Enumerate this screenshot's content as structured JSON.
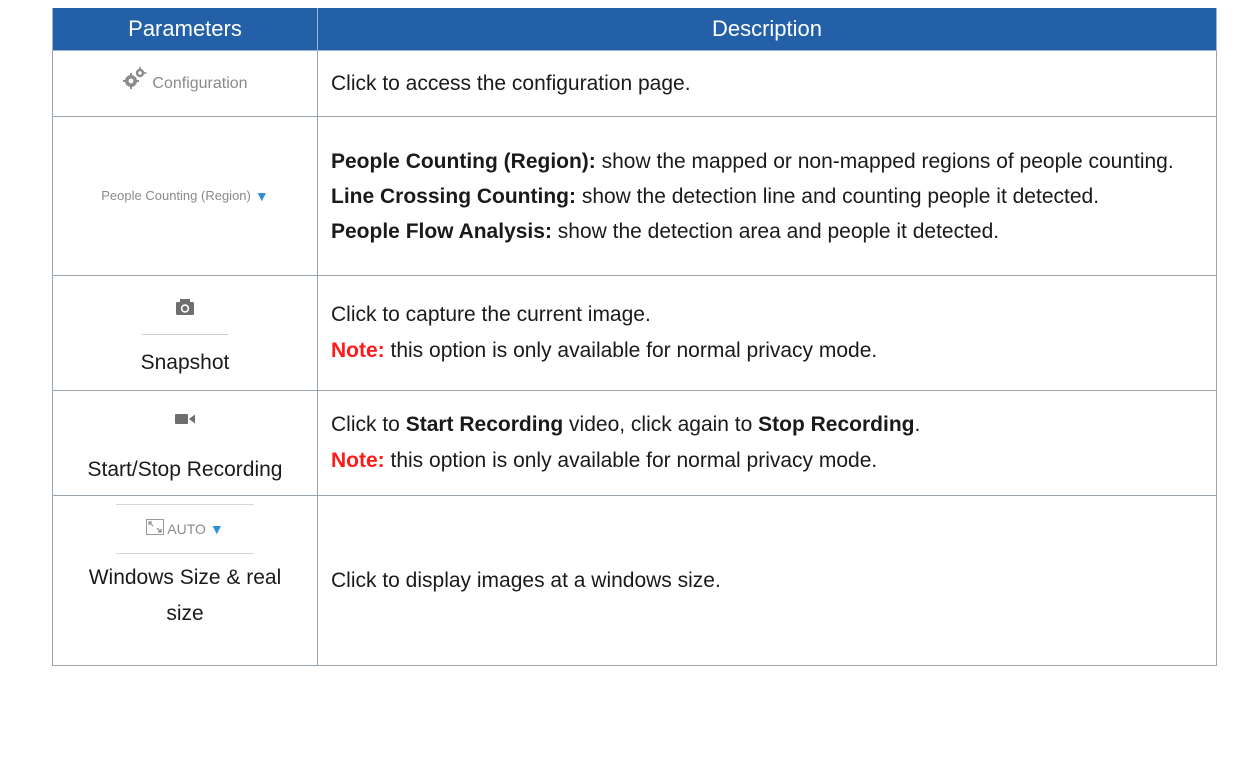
{
  "header": {
    "col1": "Parameters",
    "col2": "Description"
  },
  "rows": [
    {
      "param_label": "Configuration",
      "param_icon": "gears-icon",
      "desc": "Click to access the configuration page."
    },
    {
      "param_label": "People Counting (Region)",
      "param_icon": "caret-down-icon",
      "items": [
        {
          "term": "People Counting (Region):",
          "text": " show the mapped or non-mapped regions of people counting."
        },
        {
          "term": "Line Crossing Counting:",
          "text": " show the detection line and counting people it detected."
        },
        {
          "term": "People Flow Analysis:",
          "text": " show the detection area and people it detected."
        }
      ]
    },
    {
      "param_label": "Snapshot",
      "param_icon": "camera-icon",
      "desc": "Click to capture the current image.",
      "note_label": "Note:",
      "note_text": " this option is only available for normal privacy mode."
    },
    {
      "param_label": "Start/Stop Recording",
      "param_icon": "video-camera-icon",
      "desc_pre": "Click to ",
      "desc_strong1": "Start Recording",
      "desc_mid": " video, click again to ",
      "desc_strong2": "Stop Recording",
      "desc_end": ".",
      "note_label": "Note:",
      "note_text": " this option is only available for normal privacy mode."
    },
    {
      "param_ui_label": "AUTO",
      "param_label": "Windows Size & real size",
      "param_icon": "window-resize-icon",
      "desc": "Click to display images at a windows size."
    }
  ],
  "colors": {
    "header_bg": "#2360a8",
    "note": "#ff1a1a",
    "caret": "#2f8fd6"
  }
}
